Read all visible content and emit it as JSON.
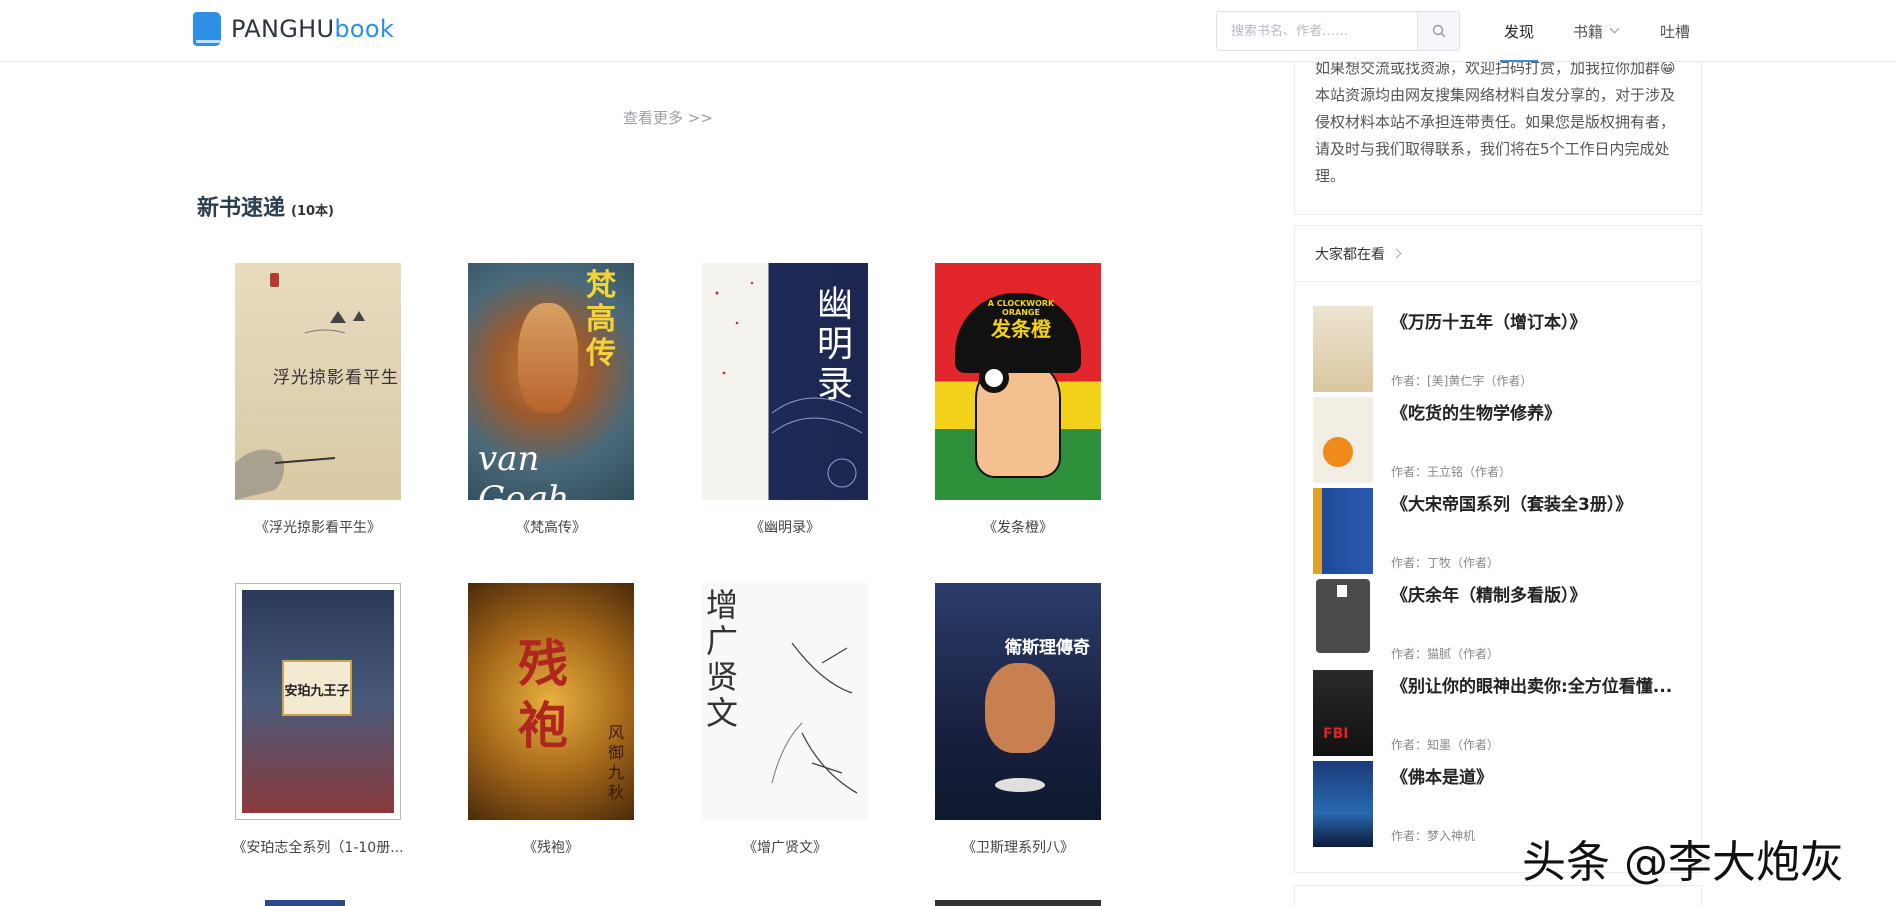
{
  "header": {
    "logo_main": "PANGHU",
    "logo_accent": "book",
    "search_placeholder": "搜索书名、作者……",
    "nav": [
      {
        "label": "发现"
      },
      {
        "label": "书籍"
      },
      {
        "label": "吐槽"
      }
    ]
  },
  "main": {
    "more_link": "查看更多 >>",
    "section_title": "新书速递",
    "section_count": "(10本)",
    "books": [
      {
        "title": "《浮光掠影看平生》"
      },
      {
        "title": "《梵高传》"
      },
      {
        "title": "《幽明录》"
      },
      {
        "title": "《发条橙》"
      },
      {
        "title": "《安珀志全系列（1-10册..."
      },
      {
        "title": "《残袍》"
      },
      {
        "title": "《增广贤文》"
      },
      {
        "title": "《卫斯理系列八》"
      }
    ],
    "cover_text": {
      "b1": "浮光掠影看平生",
      "b2_cn": "梵高传",
      "b2_en": "van Gogh",
      "b3": "幽明录",
      "b4_en": "A CLOCKWORK ORANGE",
      "b4_cn": "发条橙",
      "b5": "安珀九王子",
      "b6": "残袍",
      "b6_side": "风御九秋",
      "b7": "增广贤文",
      "b8": "衛斯理傳奇"
    }
  },
  "sidebar": {
    "notice_lines": [
      "如果想交流或找资源，欢迎扫码打赏，加我拉你加群😁",
      "本站资源均由网友搜集网络材料自发分享的，对于涉及",
      "侵权材料本站不承担连带责任。如果您是版权拥有者，",
      "请及时与我们取得联系，我们将在5个工作日内完成处",
      "理。"
    ],
    "hot_heading": "大家都在看",
    "hot": [
      {
        "title": "《万历十五年（增订本）》",
        "author": "作者：[美]黄仁宇（作者）"
      },
      {
        "title": "《吃货的生物学修养》",
        "author": "作者：王立铭（作者）"
      },
      {
        "title": "《大宋帝国系列（套装全3册）》",
        "author": "作者：丁牧（作者）"
      },
      {
        "title": "《庆余年（精制多看版）》",
        "author": "作者：猫腻（作者）"
      },
      {
        "title": "《别让你的眼神出卖你:全方位看懂...",
        "author": "作者：知墨（作者）"
      },
      {
        "title": "《佛本是道》",
        "author": "作者：梦入神机"
      }
    ]
  },
  "watermark": "头条 @李大炮灰",
  "colors": {
    "accent": "#2f8fe6",
    "text_dark": "#2c3e50",
    "muted": "#888888"
  }
}
